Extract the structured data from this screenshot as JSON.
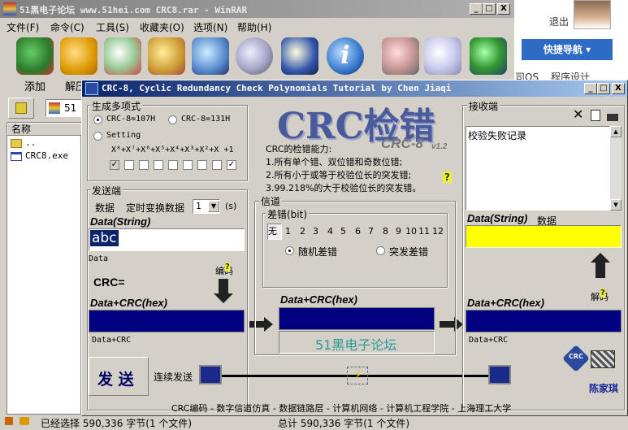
{
  "winrar": {
    "title": "51黑电子论坛 www.51hei.com CRC8.rar - WinRAR",
    "menu": [
      "文件(F)",
      "命令(C)",
      "工具(S)",
      "收藏夹(O)",
      "选项(N)",
      "帮助(H)"
    ],
    "add_label": "添加",
    "extract_label": "解压",
    "file_col": "名称",
    "files": [
      "..",
      "CRC8.exe"
    ],
    "status_left": "已经选择 590,336 字节(1 个文件)",
    "status_right": "总计 590,336 字节(1 个文件)",
    "window_buttons": [
      "_",
      "□",
      "X"
    ]
  },
  "browser": {
    "logout": "退出",
    "quick_nav": "快捷导航",
    "frag1": "司OS",
    "frag2": "程序设计"
  },
  "crc": {
    "title": "CRC-8, Cyclic Redundancy Check Polynomials Tutorial by Chen Jiaqi",
    "poly": {
      "group": "生成多项式",
      "opt1": "CRC-8=107H",
      "opt2": "CRC-8=131H",
      "opt3": "Setting",
      "formula": "X⁸+X⁷+X⁶+X⁵+X⁴+X³+X²+X +1"
    },
    "logo": {
      "main": "CRC检错",
      "sub": "CRC-8",
      "ver": "v1.2"
    },
    "ability": {
      "title": "CRC的检错能力:",
      "l1": "1.所有单个错、双位错和奇数位错;",
      "l2": "2.所有小于或等于校验位长的突发错;",
      "l3": "3.99.218%的大于校验位长的突发错。"
    },
    "sender": {
      "group": "发送端",
      "data": "数据",
      "timer": "定时变换数据",
      "interval": "1",
      "unit": "(s)",
      "data_string": "Data(String)",
      "data_value": "abc",
      "data_caption": "Data",
      "encode": "编码",
      "crc_eq": "CRC=",
      "data_crc": "Data+CRC(hex)",
      "data_crc_caption": "Data+CRC",
      "send": "发 送",
      "continuous": "连续发送"
    },
    "channel": {
      "group": "信道",
      "err_group": "差错(bit)",
      "bits": [
        "无",
        "1",
        "2",
        "3",
        "4",
        "5",
        "6",
        "7",
        "8",
        "9",
        "10",
        "11",
        "12"
      ],
      "random": "随机差错",
      "burst": "突发差错",
      "data_crc": "Data+CRC(hex)",
      "site": "51黑电子论坛"
    },
    "receiver": {
      "group": "接收端",
      "log": "校验失败记录",
      "data_string": "Data(String)",
      "data_label": "数据",
      "decode": "解码",
      "data_crc": "Data+CRC(hex)",
      "data_crc_caption": "Data+CRC",
      "author": "陈家琪",
      "crc_badge": "CRC"
    },
    "footer": "CRC编码 - 数字信道仿真 - 数据链路层 - 计算机网络 - 计算机工程学院 - 上海理工大学",
    "help": "?"
  },
  "colors": {
    "title_bar": "#0a246a",
    "navy": "#000080",
    "yellow": "#ffff00",
    "logo": "#4a5a9a"
  }
}
